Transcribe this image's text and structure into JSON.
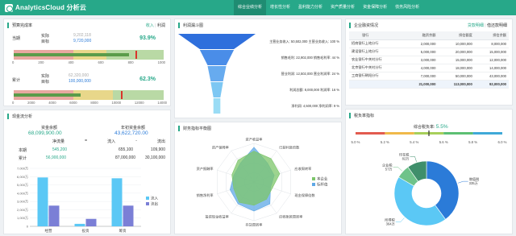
{
  "app": {
    "title": "AnalyticsCloud 分析云"
  },
  "nav": [
    "综合业绩分析",
    "增长性分析",
    "盈利能力分析",
    "资产质量分析",
    "资金保障分析",
    "债务风险分析"
  ],
  "colors": {
    "brand": "#27a889",
    "blue": "#2b7bd8",
    "cyan": "#5bc8f5"
  },
  "budget": {
    "title": "预算完成率",
    "toggle": [
      "收入",
      "利润"
    ],
    "current": {
      "label": "当期",
      "actual_label": "实际",
      "target_label": "目标",
      "actual": "9,202,118",
      "target": "9,720,000",
      "rate": "93.9%",
      "actual_value": 9202118,
      "target_value": 9720000,
      "axis_max": 12000000
    },
    "cumulative": {
      "label": "累计",
      "actual_label": "实际",
      "target_label": "目标",
      "actual": "62,320,000",
      "target": "100,000,000",
      "rate": "62.3%",
      "actual_value": 62320000,
      "target_value": 100000000,
      "axis_max": 140000000
    },
    "ticks_current": [
      "0",
      "200",
      "400",
      "600",
      "800",
      "1000"
    ],
    "ticks_cumulative": [
      "0",
      "2000",
      "4000",
      "6000",
      "8000",
      "10000",
      "12000",
      "14000"
    ]
  },
  "cashflow": {
    "title": "现金流分析",
    "balance_label": "资金余额",
    "balance": "68,099,900.00",
    "daily_label": "年初资金余额",
    "daily": "43,622,720.00",
    "headers": [
      "净流量",
      "=",
      "流入",
      "-",
      "流出"
    ],
    "rows": [
      {
        "label": "本期",
        "net": "545,200",
        "inflow": "655,100",
        "outflow": "109,900"
      },
      {
        "label": "累计",
        "net": "56,900,000",
        "inflow": "87,000,000",
        "outflow": "30,100,000"
      }
    ],
    "chart_data": {
      "type": "bar",
      "categories": [
        "经营",
        "投资",
        "筹资"
      ],
      "series": [
        {
          "name": "流入",
          "values": [
            5900000,
            300000,
            5800000
          ],
          "color": "#5bc8f5"
        },
        {
          "name": "流出",
          "values": [
            2500000,
            900000,
            2500000
          ],
          "color": "#7b7fd6"
        }
      ],
      "yticks": [
        "7,000万",
        "6,000万",
        "5,000万",
        "4,000万",
        "3,000万",
        "2,000万",
        "1,000万",
        "0"
      ],
      "ylim": [
        0,
        7000000
      ]
    }
  },
  "profit_funnel": {
    "title": "利润漏斗图",
    "chart_data": {
      "type": "funnel",
      "stages": [
        {
          "label": "主营业务收入: 50,502,000 主营业务收入: 100 %",
          "value": 100
        },
        {
          "label": "销售毛利: 22,902,000 销售毛利率: 44 %",
          "value": 44
        },
        {
          "label": "营业利润: 12,502,000 营业利润率: 24 %",
          "value": 24
        },
        {
          "label": "利润总额: 8,000,000 利润率: 16 %",
          "value": 16
        },
        {
          "label": "净利润: 4,500,000 净利润率: 9 %",
          "value": 9
        }
      ]
    }
  },
  "finance_radar": {
    "title": "财务指标平衡图",
    "chart_data": {
      "type": "radar",
      "axes": [
        "资产收益率",
        "已获利息倍数",
        "应收周转率",
        "现金保障倍数",
        "应收账款周转率",
        "存货周转率",
        "投资现金收益率",
        "销售净利率",
        "资产报酬率",
        "资产保障率"
      ],
      "series": [
        {
          "name": "本企业",
          "values": [
            0.8,
            0.75,
            0.7,
            0.5,
            0.55,
            0.6,
            0.65,
            0.55,
            0.6,
            0.7
          ],
          "color": "#7cc56a"
        },
        {
          "name": "标杆值",
          "values": [
            0.9,
            0.6,
            0.55,
            0.45,
            0.7,
            0.75,
            0.7,
            0.65,
            0.55,
            0.6
          ],
          "color": "#5fa8e6"
        }
      ]
    }
  },
  "loans": {
    "title": "企业融资情况",
    "tabs": [
      "贷款明细",
      "借还款明细"
    ],
    "columns": [
      "银行",
      "融资余额",
      "授信额度",
      "授信余额"
    ],
    "rows": [
      [
        "招商银行上地分行",
        "2,000,000",
        "10,000,000",
        "8,000,000"
      ],
      [
        "建设银行上地分行",
        "5,000,000",
        "20,000,000",
        "15,000,000"
      ],
      [
        "农业银行中关村分行",
        "3,000,000",
        "15,000,000",
        "12,000,000"
      ],
      [
        "北京银行中关村分行",
        "4,000,000",
        "18,000,000",
        "14,000,000"
      ],
      [
        "工商银行朝阳分行",
        "7,000,000",
        "50,000,000",
        "43,000,000"
      ]
    ],
    "total": [
      "",
      "21,000,000",
      "113,000,000",
      "92,000,000"
    ]
  },
  "tax": {
    "title": "税负率指标",
    "rate_label": "综合税负率:",
    "rate": "5.5%",
    "gauge_ticks": [
      "5.0 %",
      "5.2 %",
      "5.4 %",
      "5.6 %",
      "5.8 %",
      "6.0 %"
    ],
    "gauge_value": 5.5,
    "gauge_range": [
      5.0,
      6.0
    ],
    "chart_data": {
      "type": "pie",
      "slices": [
        {
          "name": "增值税",
          "value": 335,
          "label": "增值税\n335万",
          "color": "#2b7bd8"
        },
        {
          "name": "所得税",
          "value": 364,
          "label": "所得税\n364万",
          "color": "#5bc8f5"
        },
        {
          "name": "企业税",
          "value": 57,
          "label": "企业税\n57万",
          "color": "#6fc38a"
        },
        {
          "name": "印花税",
          "value": 82,
          "label": "印花税\n82万",
          "color": "#3f8f6b"
        }
      ]
    }
  }
}
